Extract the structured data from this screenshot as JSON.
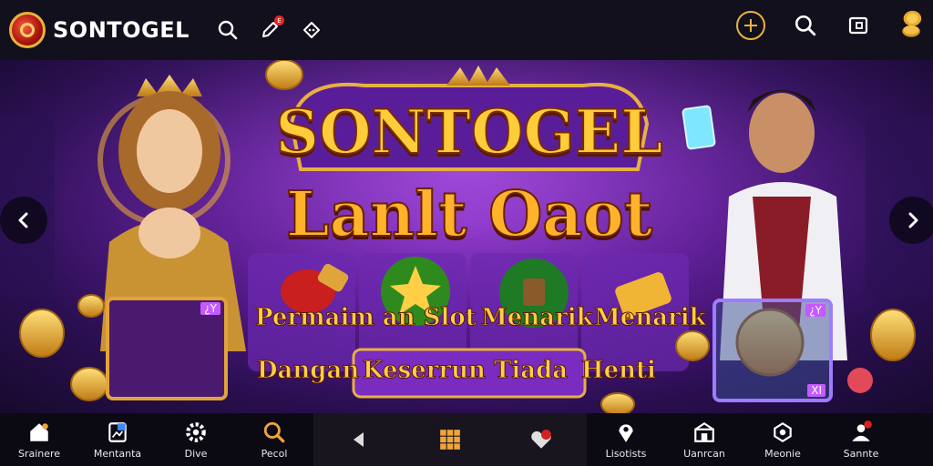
{
  "header": {
    "brand": "SONTOGEL",
    "icons": [
      "logo-icon",
      "search-icon",
      "pencil-badge-icon",
      "chat-icon",
      "target-icon",
      "search-icon",
      "tablet-icon",
      "coin-stack-icon"
    ]
  },
  "banner": {
    "title_line1": "SONTOGEL",
    "title_line2": "Lanlt Oaot",
    "tagline_left": "Permaim an Slot",
    "tagline_mid": "Menarik",
    "tagline_right": "Menarik",
    "subline_left": "Dangan",
    "subline_box": "Keserrun Tiada",
    "subline_right": "Henti",
    "panel_left_tag": "¿Y",
    "panel_right_tag": "¿Y",
    "panel_right_bottom_tag": "XI",
    "colors": {
      "accent": "#ffcc3a",
      "purple": "#7a2bc0",
      "gold_border": "#e1a43b"
    }
  },
  "bottom_nav": {
    "items": [
      {
        "label": "Srainere",
        "icon": "home-icon"
      },
      {
        "label": "Mentanta",
        "icon": "document-icon"
      },
      {
        "label": "Dive",
        "icon": "gear-icon"
      },
      {
        "label": "Pecol",
        "icon": "search-icon"
      },
      {
        "label": "Lisotists",
        "icon": "pin-icon"
      },
      {
        "label": "Uanrcan",
        "icon": "store-icon"
      },
      {
        "label": "Meonie",
        "icon": "refresh-icon"
      },
      {
        "label": "Sannte",
        "icon": "profile-icon"
      }
    ],
    "center_icons": [
      "back-icon",
      "grid-icon",
      "heart-icon"
    ]
  }
}
